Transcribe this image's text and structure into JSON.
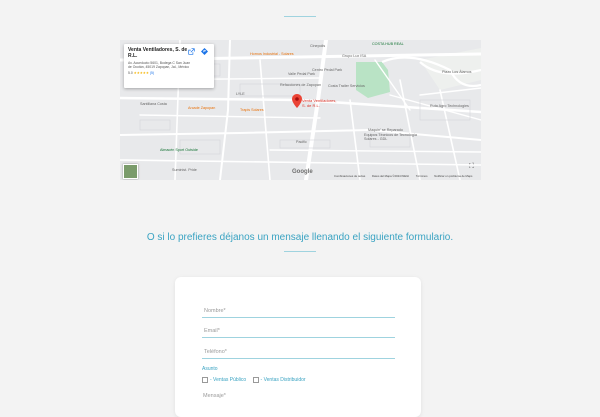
{
  "map": {
    "card": {
      "name": "Venta Ventiladores, S. de R.L.",
      "address": "Av. Acueducto 5601, Bodega C San Juan de Ocotán, 45019 Zapopan, Jal., México",
      "rating_value": "5.0",
      "rating_stars": "★★★★★",
      "rating_reviews": "(5)"
    },
    "pin_label_line1": "Venta Ventiladores,",
    "pin_label_line2": "S. de R.L.",
    "labels": {
      "hornos": "Hornos Industrial - Solares",
      "raphi": "Valle Pedal Park",
      "pedal": "Centro Pedal Park",
      "refacciones": "Refacciones de Zapopan",
      "costa_trailer": "Costa Trailer Servicios",
      "solares": "Trapis Solares",
      "alwaim": "Almacén Sport Outside",
      "suministros": "Suminist. Pride",
      "santillana": "Santillana Costa",
      "lyle": "LYLE",
      "arcade": "Arcade Zapopan",
      "grupo": "Grupo Lux ISA",
      "costa_hub": "COSTA HUB REAL",
      "ciudad": "Cinepolis",
      "solares_tech": "Equipos Técnicos de Tecnología Solares - GDL",
      "ruta": "Ruta Agro Technologies",
      "ajuste": "Maquin' se Reparado",
      "plazoleta": "Plazo Los Álamos",
      "pacific": "Pacific"
    },
    "google": "Google",
    "footer": {
      "shortcuts": "Combinaciones de teclas",
      "data": "Datos del Mapa ©2024 INEGI",
      "terms": "Términos",
      "report": "Notificar un problema de Maps"
    }
  },
  "intro_text": "O si lo prefieres déjanos un mensaje llenando el siguiente formulario.",
  "form": {
    "name_placeholder": "Nombre*",
    "email_placeholder": "Email*",
    "phone_placeholder": "Teléfono*",
    "subject_label": "Asunto",
    "option1": "- Ventas Público",
    "option2": "- Ventas Distribuidor",
    "message_placeholder": "Mensaje*"
  }
}
